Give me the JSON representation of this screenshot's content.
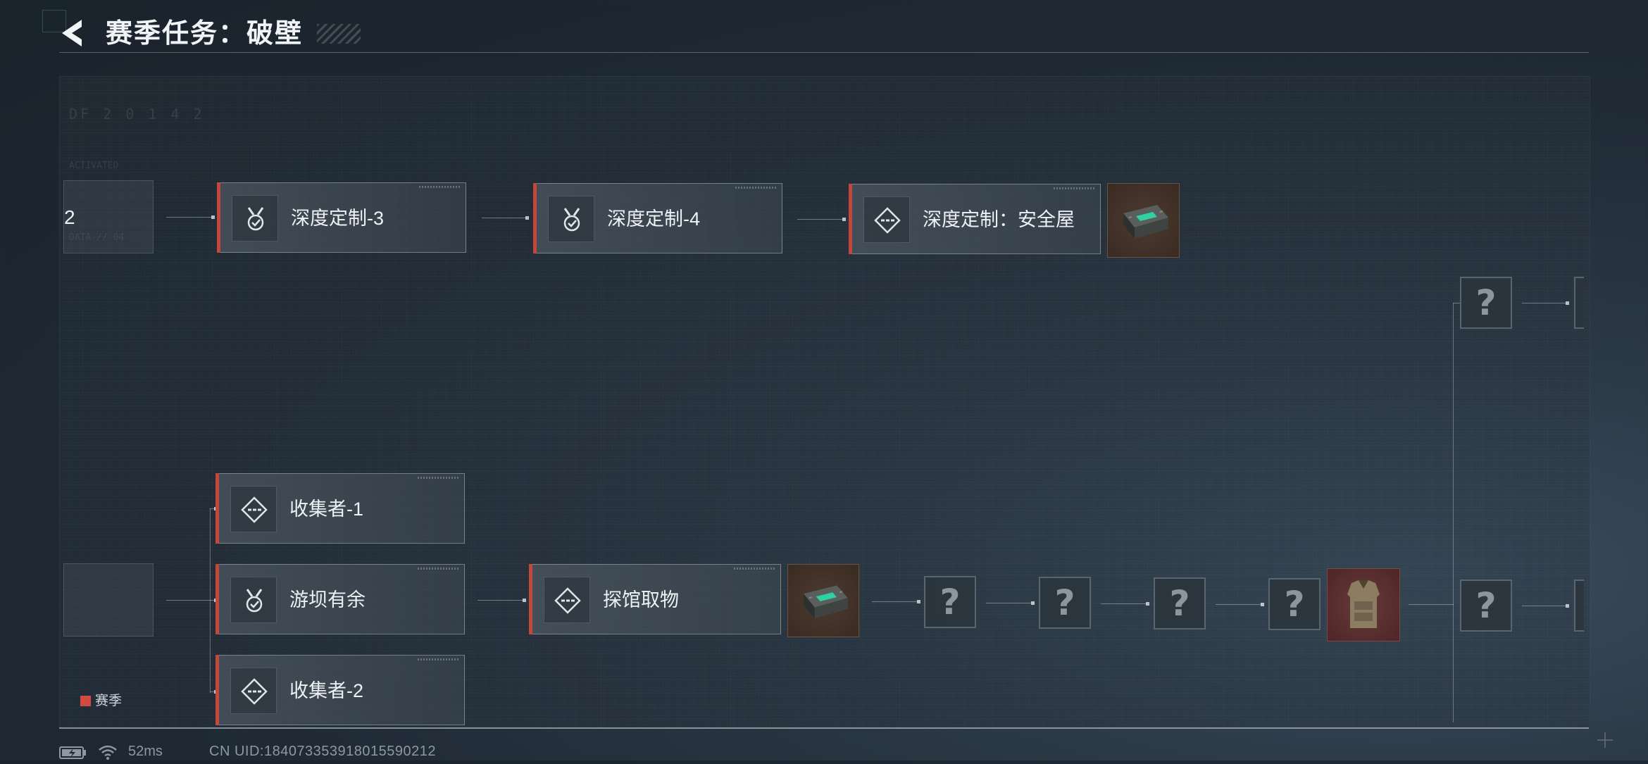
{
  "header": {
    "title": "赛季任务：破壁"
  },
  "top_row": {
    "partial_label": "2",
    "nodes": [
      {
        "label": "深度定制-3",
        "icon": "medal-check-icon"
      },
      {
        "label": "深度定制-4",
        "icon": "medal-check-icon"
      },
      {
        "label": "深度定制：安全屋",
        "icon": "diamond-dash-icon"
      }
    ],
    "reward": {
      "icon": "safebox-case-icon"
    }
  },
  "bottom_branch": {
    "nodes": [
      {
        "label": "收集者-1",
        "icon": "diamond-dash-icon"
      },
      {
        "label": "游坝有余",
        "icon": "medal-check-icon"
      },
      {
        "label": "收集者-2",
        "icon": "diamond-dash-icon"
      }
    ],
    "next_node": {
      "label": "探馆取物",
      "icon": "diamond-dash-icon"
    },
    "reward": {
      "icon": "safebox-case-icon"
    },
    "unknown_symbol": "?",
    "armor_reward": {
      "icon": "body-armor-icon"
    }
  },
  "legend": {
    "label": "赛季",
    "color": "#d24a40"
  },
  "status_bar": {
    "ping": "52ms",
    "uid": "CN UID:1840733539180155902 12"
  },
  "faded_text": {
    "code": "DF  2  0  1  4  2",
    "line1": "ACTIVATED",
    "line2": "DATA // 04"
  }
}
